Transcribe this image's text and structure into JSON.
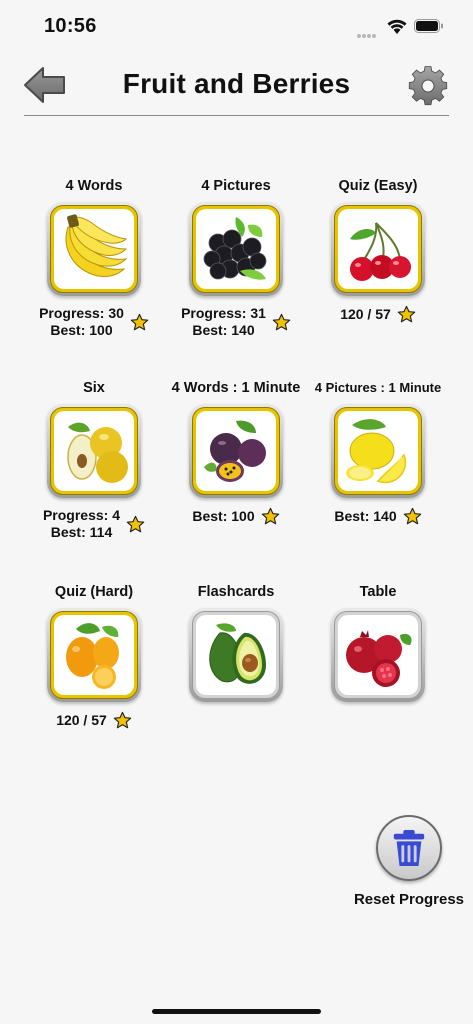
{
  "status_bar": {
    "time": "10:56"
  },
  "header": {
    "title": "Fruit and Berries"
  },
  "games": [
    {
      "title": "4 Words",
      "line1": "Progress: 30",
      "line2": "Best: 100",
      "icon": "banana-icon"
    },
    {
      "title": "4 Pictures",
      "line1": "Progress: 31",
      "line2": "Best: 140",
      "icon": "blackberry-icon"
    },
    {
      "title": "Quiz (Easy)",
      "line1": "120 / 57",
      "line2": "",
      "icon": "cherry-icon"
    },
    {
      "title": "Six",
      "line1": "Progress: 4",
      "line2": "Best: 114",
      "icon": "quince-icon"
    },
    {
      "title": "4 Words : 1 Minute",
      "line1": "Best: 100",
      "line2": "",
      "icon": "passion-fruit-icon"
    },
    {
      "title": "4 Pictures : 1 Minute",
      "line1": "Best: 140",
      "line2": "",
      "icon": "lemon-icon"
    },
    {
      "title": "Quiz (Hard)",
      "line1": "120 / 57",
      "line2": "",
      "icon": "kumquat-icon"
    },
    {
      "title": "Flashcards",
      "line1": "",
      "line2": "",
      "icon": "avocado-icon"
    },
    {
      "title": "Table",
      "line1": "",
      "line2": "",
      "icon": "pomegranate-icon"
    }
  ],
  "reset": {
    "label": "Reset Progress",
    "icon": "trash-icon"
  },
  "colors": {
    "gold_border": "#e6c400",
    "star": "#f2c200",
    "reset_icon": "#3b4bd1"
  }
}
